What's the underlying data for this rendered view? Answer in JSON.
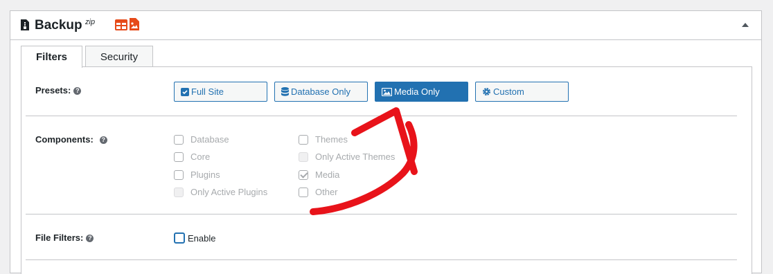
{
  "header": {
    "title": "Backup",
    "title_sup": "zip",
    "icons": [
      "file-zip-icon",
      "database-table-icon",
      "media-file-icon",
      "collapse-arrow-icon"
    ]
  },
  "tabs": [
    {
      "label": "Filters",
      "active": true
    },
    {
      "label": "Security",
      "active": false
    }
  ],
  "presets": {
    "label": "Presets:",
    "buttons": [
      {
        "label": "Full Site",
        "icon": "checkbox-icon",
        "selected": false
      },
      {
        "label": "Database Only",
        "icon": "database-icon",
        "selected": false
      },
      {
        "label": "Media Only",
        "icon": "image-icon",
        "selected": true
      },
      {
        "label": "Custom",
        "icon": "gear-icon",
        "selected": false
      }
    ]
  },
  "components": {
    "label": "Components:",
    "col1": [
      {
        "label": "Database",
        "checked": false
      },
      {
        "label": "Core",
        "checked": false
      },
      {
        "label": "Plugins",
        "checked": false
      },
      {
        "label": "Only Active Plugins",
        "checked": false
      }
    ],
    "col2": [
      {
        "label": "Themes",
        "checked": false
      },
      {
        "label": "Only Active Themes",
        "checked": false
      },
      {
        "label": "Media",
        "checked": true
      },
      {
        "label": "Other",
        "checked": false
      }
    ]
  },
  "file_filters": {
    "label": "File Filters:",
    "enable_label": "Enable",
    "enabled": false
  },
  "help_glyph": "?",
  "colors": {
    "accent": "#2271b1",
    "header_icon": "#e64a19",
    "annotation_arrow": "#e8131a"
  }
}
